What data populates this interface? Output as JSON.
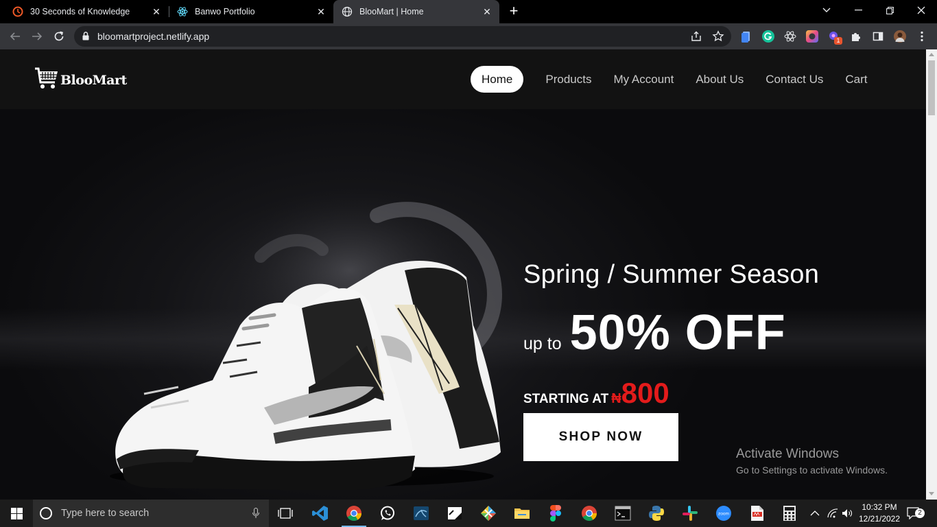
{
  "browser": {
    "tabs": [
      {
        "title": "30 Seconds of Knowledge",
        "active": false
      },
      {
        "title": "Banwo Portfolio",
        "active": false
      },
      {
        "title": "BlooMart | Home",
        "active": true
      }
    ],
    "url": "bloomartproject.netlify.app",
    "extension_badge": "1"
  },
  "site": {
    "logo_text": "BlooMart",
    "nav": [
      {
        "label": "Home",
        "active": true
      },
      {
        "label": "Products",
        "active": false
      },
      {
        "label": "My Account",
        "active": false
      },
      {
        "label": "About Us",
        "active": false
      },
      {
        "label": "Contact Us",
        "active": false
      },
      {
        "label": "Cart",
        "active": false
      }
    ],
    "hero": {
      "season": "Spring / Summer Season",
      "upto": "up to",
      "discount": "50% OFF",
      "starting_at": "STARTING AT",
      "currency_symbol": "₦",
      "price": "800",
      "cta": "SHOP NOW"
    },
    "accent_color": "#e31b1b"
  },
  "watermark": {
    "line1": "Activate Windows",
    "line2": "Go to Settings to activate Windows."
  },
  "taskbar": {
    "search_placeholder": "Type here to search",
    "time": "10:32 PM",
    "date": "12/21/2022",
    "notification_count": "2"
  }
}
